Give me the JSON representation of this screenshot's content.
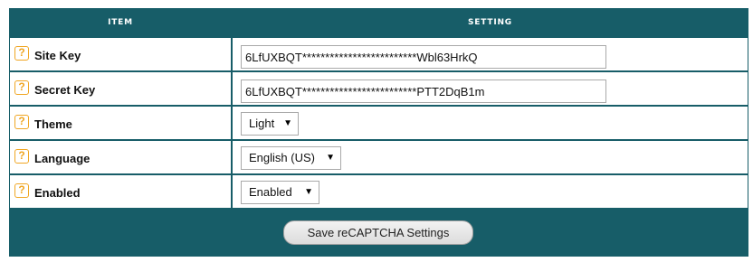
{
  "table": {
    "headers": {
      "item": "ITEM",
      "setting": "SETTING"
    },
    "rows": [
      {
        "label": "Site Key",
        "control": "text",
        "value": "6LfUXBQT*************************Wbl63HrkQ"
      },
      {
        "label": "Secret Key",
        "control": "text",
        "value": "6LfUXBQT*************************PTT2DqB1m"
      },
      {
        "label": "Theme",
        "control": "select",
        "value": "Light"
      },
      {
        "label": "Language",
        "control": "select",
        "value": "English (US)"
      },
      {
        "label": "Enabled",
        "control": "select",
        "value": "Enabled"
      }
    ],
    "help_icon_glyph": "?",
    "select_arrow_glyph": "▼"
  },
  "footer": {
    "save_label": "Save reCAPTCHA Settings"
  },
  "colors": {
    "panel": "#175d68",
    "help_icon": "#f0a623",
    "row_bg": "#ffffff"
  }
}
